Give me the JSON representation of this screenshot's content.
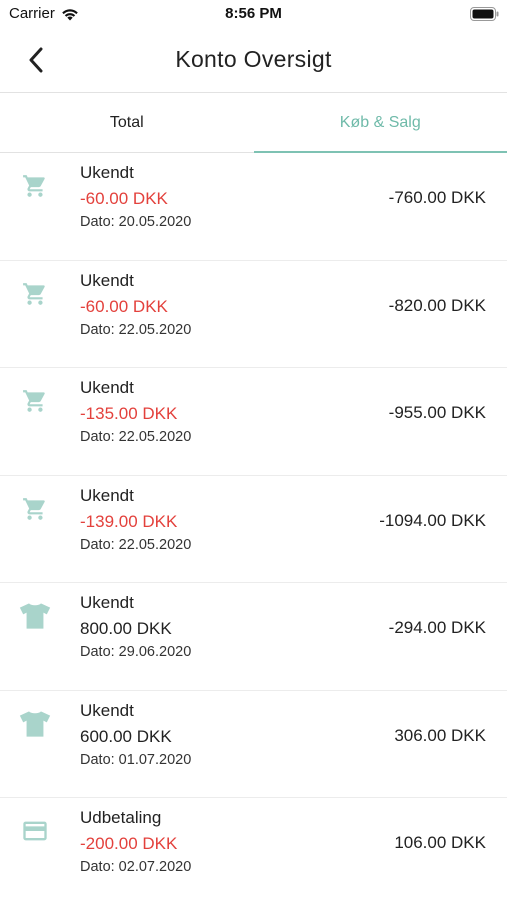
{
  "status_bar": {
    "carrier": "Carrier",
    "time": "8:56 PM"
  },
  "header": {
    "title": "Konto Oversigt"
  },
  "tabs": [
    {
      "label": "Total",
      "active": false
    },
    {
      "label": "Køb & Salg",
      "active": true
    }
  ],
  "colors": {
    "accent": "#6fbaa9",
    "icon": "#a9d4cb",
    "negative": "#e3413c"
  },
  "transactions": [
    {
      "icon": "cart-icon",
      "title": "Ukendt",
      "amount": "-60.00 DKK",
      "negative": true,
      "date": "Dato: 20.05.2020",
      "balance": "-760.00 DKK"
    },
    {
      "icon": "cart-icon",
      "title": "Ukendt",
      "amount": "-60.00 DKK",
      "negative": true,
      "date": "Dato: 22.05.2020",
      "balance": "-820.00 DKK"
    },
    {
      "icon": "cart-icon",
      "title": "Ukendt",
      "amount": "-135.00 DKK",
      "negative": true,
      "date": "Dato: 22.05.2020",
      "balance": "-955.00 DKK"
    },
    {
      "icon": "cart-icon",
      "title": "Ukendt",
      "amount": "-139.00 DKK",
      "negative": true,
      "date": "Dato: 22.05.2020",
      "balance": "-1094.00 DKK"
    },
    {
      "icon": "tshirt-icon",
      "title": "Ukendt",
      "amount": "800.00 DKK",
      "negative": false,
      "date": "Dato: 29.06.2020",
      "balance": "-294.00 DKK"
    },
    {
      "icon": "tshirt-icon",
      "title": "Ukendt",
      "amount": "600.00 DKK",
      "negative": false,
      "date": "Dato: 01.07.2020",
      "balance": "306.00 DKK"
    },
    {
      "icon": "credit-card-icon",
      "title": "Udbetaling",
      "amount": "-200.00 DKK",
      "negative": true,
      "date": "Dato: 02.07.2020",
      "balance": "106.00 DKK"
    }
  ]
}
